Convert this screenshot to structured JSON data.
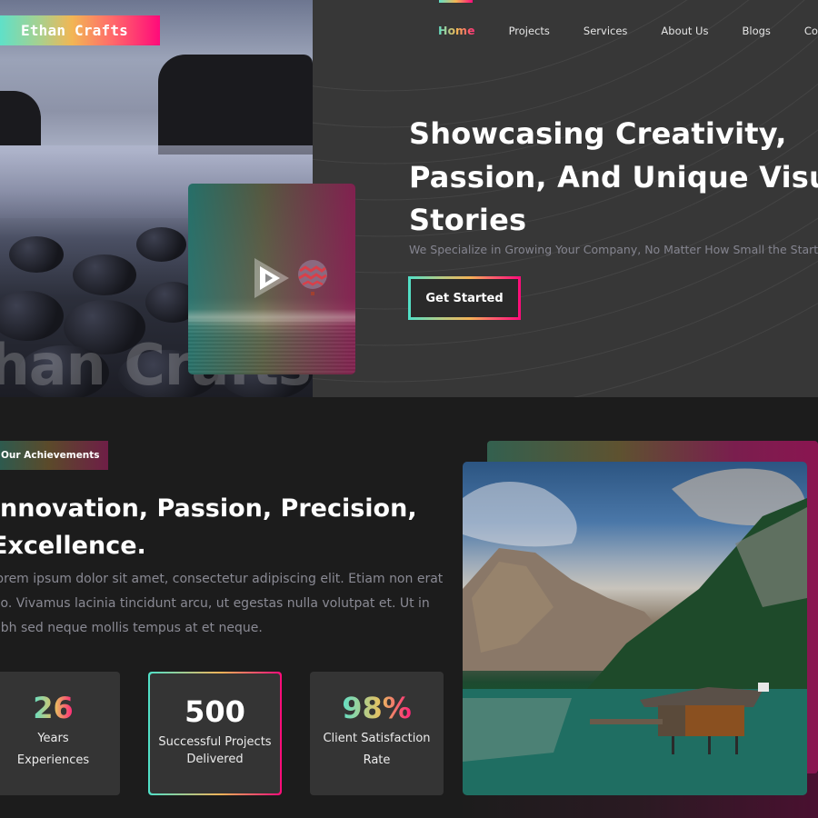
{
  "brand": {
    "name": "Ethan Crafts",
    "watermark": "than Crafts"
  },
  "nav": {
    "items": [
      {
        "label": "Home",
        "active": true
      },
      {
        "label": "Projects",
        "active": false
      },
      {
        "label": "Services",
        "active": false
      },
      {
        "label": "About Us",
        "active": false
      },
      {
        "label": "Blogs",
        "active": false
      },
      {
        "label": "Contact",
        "active": false
      }
    ]
  },
  "hero": {
    "title_lines": [
      "Showcasing Creativity,",
      "Passion, And Unique Visual",
      "Stories"
    ],
    "subtitle": "We Specialize in Growing Your Company, No Matter How Small the Start",
    "cta_label": "Get Started",
    "video": {
      "icon": "play-icon"
    }
  },
  "achievements": {
    "badge": "Our Achievements",
    "title_lines": [
      "Innovation, Passion, Precision,",
      "Excellence."
    ],
    "body_lines": [
      "Lorem ipsum dolor sit amet, consectetur adipiscing elit. Etiam non erat",
      "leo. Vivamus lacinia tincidunt arcu, ut egestas nulla volutpat et. Ut in",
      "nibh sed neque mollis tempus at et neque."
    ],
    "stats": [
      {
        "value": "26",
        "label_lines": [
          "Years",
          "Experiences"
        ],
        "highlighted": false
      },
      {
        "value": "500",
        "label_lines": [
          "Successful Projects",
          "Delivered"
        ],
        "highlighted": true
      },
      {
        "value": "98%",
        "label_lines": [
          "Client Satisfaction",
          "Rate"
        ],
        "highlighted": false
      }
    ]
  },
  "colors": {
    "gradient_start": "#5fe0c8",
    "gradient_mid": "#f2b654",
    "gradient_end": "#ff0a7a",
    "hero_bg": "#373737",
    "page_bg": "#1c1c1c",
    "card_bg": "#343434"
  }
}
